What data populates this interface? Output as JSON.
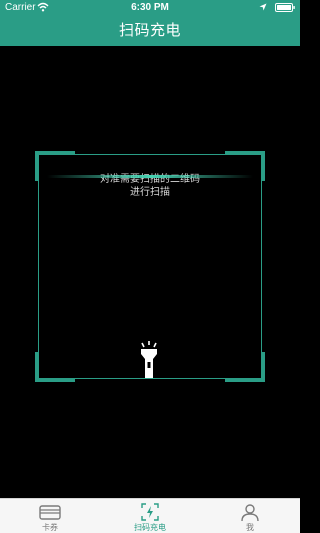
{
  "status_bar": {
    "carrier": "Carrier",
    "time": "6:30 PM",
    "battery_text": "",
    "icons": [
      "wifi-icon",
      "location-icon",
      "battery-icon"
    ]
  },
  "header": {
    "title": "扫码充电"
  },
  "scanner": {
    "hint_line1": "对准需要扫描的二维码",
    "hint_line2": "进行扫描",
    "flashlight_icon": "flashlight-icon"
  },
  "tabbar": {
    "tabs": [
      {
        "label": "卡券",
        "icon": "card-icon",
        "active": false
      },
      {
        "label": "扫码充电",
        "icon": "scan-charge-icon",
        "active": true
      },
      {
        "label": "我",
        "icon": "user-icon",
        "active": false
      }
    ]
  },
  "colors": {
    "brand": "#2a9d86",
    "background": "#000000",
    "tabbar_bg": "#f6f6f6",
    "inactive": "#7a7a7a"
  }
}
